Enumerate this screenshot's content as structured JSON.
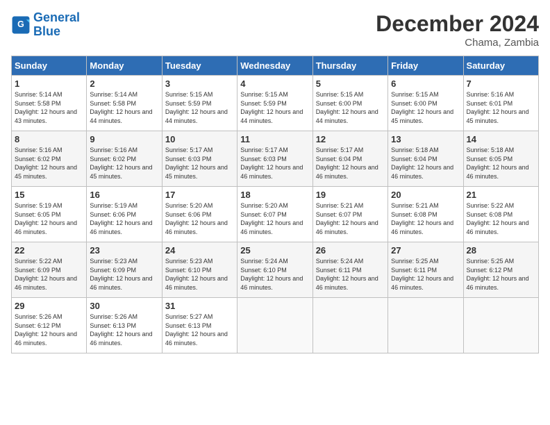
{
  "logo": {
    "line1": "General",
    "line2": "Blue"
  },
  "title": "December 2024",
  "location": "Chama, Zambia",
  "days_of_week": [
    "Sunday",
    "Monday",
    "Tuesday",
    "Wednesday",
    "Thursday",
    "Friday",
    "Saturday"
  ],
  "weeks": [
    [
      {
        "day": 1,
        "sunrise": "5:14 AM",
        "sunset": "5:58 PM",
        "daylight": "12 hours and 43 minutes"
      },
      {
        "day": 2,
        "sunrise": "5:14 AM",
        "sunset": "5:58 PM",
        "daylight": "12 hours and 44 minutes"
      },
      {
        "day": 3,
        "sunrise": "5:15 AM",
        "sunset": "5:59 PM",
        "daylight": "12 hours and 44 minutes"
      },
      {
        "day": 4,
        "sunrise": "5:15 AM",
        "sunset": "5:59 PM",
        "daylight": "12 hours and 44 minutes"
      },
      {
        "day": 5,
        "sunrise": "5:15 AM",
        "sunset": "6:00 PM",
        "daylight": "12 hours and 44 minutes"
      },
      {
        "day": 6,
        "sunrise": "5:15 AM",
        "sunset": "6:00 PM",
        "daylight": "12 hours and 45 minutes"
      },
      {
        "day": 7,
        "sunrise": "5:16 AM",
        "sunset": "6:01 PM",
        "daylight": "12 hours and 45 minutes"
      }
    ],
    [
      {
        "day": 8,
        "sunrise": "5:16 AM",
        "sunset": "6:02 PM",
        "daylight": "12 hours and 45 minutes"
      },
      {
        "day": 9,
        "sunrise": "5:16 AM",
        "sunset": "6:02 PM",
        "daylight": "12 hours and 45 minutes"
      },
      {
        "day": 10,
        "sunrise": "5:17 AM",
        "sunset": "6:03 PM",
        "daylight": "12 hours and 45 minutes"
      },
      {
        "day": 11,
        "sunrise": "5:17 AM",
        "sunset": "6:03 PM",
        "daylight": "12 hours and 46 minutes"
      },
      {
        "day": 12,
        "sunrise": "5:17 AM",
        "sunset": "6:04 PM",
        "daylight": "12 hours and 46 minutes"
      },
      {
        "day": 13,
        "sunrise": "5:18 AM",
        "sunset": "6:04 PM",
        "daylight": "12 hours and 46 minutes"
      },
      {
        "day": 14,
        "sunrise": "5:18 AM",
        "sunset": "6:05 PM",
        "daylight": "12 hours and 46 minutes"
      }
    ],
    [
      {
        "day": 15,
        "sunrise": "5:19 AM",
        "sunset": "6:05 PM",
        "daylight": "12 hours and 46 minutes"
      },
      {
        "day": 16,
        "sunrise": "5:19 AM",
        "sunset": "6:06 PM",
        "daylight": "12 hours and 46 minutes"
      },
      {
        "day": 17,
        "sunrise": "5:20 AM",
        "sunset": "6:06 PM",
        "daylight": "12 hours and 46 minutes"
      },
      {
        "day": 18,
        "sunrise": "5:20 AM",
        "sunset": "6:07 PM",
        "daylight": "12 hours and 46 minutes"
      },
      {
        "day": 19,
        "sunrise": "5:21 AM",
        "sunset": "6:07 PM",
        "daylight": "12 hours and 46 minutes"
      },
      {
        "day": 20,
        "sunrise": "5:21 AM",
        "sunset": "6:08 PM",
        "daylight": "12 hours and 46 minutes"
      },
      {
        "day": 21,
        "sunrise": "5:22 AM",
        "sunset": "6:08 PM",
        "daylight": "12 hours and 46 minutes"
      }
    ],
    [
      {
        "day": 22,
        "sunrise": "5:22 AM",
        "sunset": "6:09 PM",
        "daylight": "12 hours and 46 minutes"
      },
      {
        "day": 23,
        "sunrise": "5:23 AM",
        "sunset": "6:09 PM",
        "daylight": "12 hours and 46 minutes"
      },
      {
        "day": 24,
        "sunrise": "5:23 AM",
        "sunset": "6:10 PM",
        "daylight": "12 hours and 46 minutes"
      },
      {
        "day": 25,
        "sunrise": "5:24 AM",
        "sunset": "6:10 PM",
        "daylight": "12 hours and 46 minutes"
      },
      {
        "day": 26,
        "sunrise": "5:24 AM",
        "sunset": "6:11 PM",
        "daylight": "12 hours and 46 minutes"
      },
      {
        "day": 27,
        "sunrise": "5:25 AM",
        "sunset": "6:11 PM",
        "daylight": "12 hours and 46 minutes"
      },
      {
        "day": 28,
        "sunrise": "5:25 AM",
        "sunset": "6:12 PM",
        "daylight": "12 hours and 46 minutes"
      }
    ],
    [
      {
        "day": 29,
        "sunrise": "5:26 AM",
        "sunset": "6:12 PM",
        "daylight": "12 hours and 46 minutes"
      },
      {
        "day": 30,
        "sunrise": "5:26 AM",
        "sunset": "6:13 PM",
        "daylight": "12 hours and 46 minutes"
      },
      {
        "day": 31,
        "sunrise": "5:27 AM",
        "sunset": "6:13 PM",
        "daylight": "12 hours and 46 minutes"
      },
      null,
      null,
      null,
      null
    ]
  ]
}
